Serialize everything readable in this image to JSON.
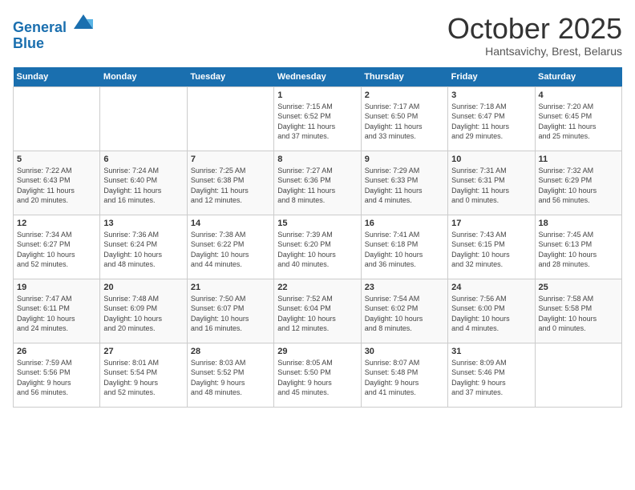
{
  "header": {
    "logo_line1": "General",
    "logo_line2": "Blue",
    "month": "October 2025",
    "location": "Hantsavichy, Brest, Belarus"
  },
  "weekdays": [
    "Sunday",
    "Monday",
    "Tuesday",
    "Wednesday",
    "Thursday",
    "Friday",
    "Saturday"
  ],
  "weeks": [
    [
      {
        "num": "",
        "detail": ""
      },
      {
        "num": "",
        "detail": ""
      },
      {
        "num": "",
        "detail": ""
      },
      {
        "num": "1",
        "detail": "Sunrise: 7:15 AM\nSunset: 6:52 PM\nDaylight: 11 hours\nand 37 minutes."
      },
      {
        "num": "2",
        "detail": "Sunrise: 7:17 AM\nSunset: 6:50 PM\nDaylight: 11 hours\nand 33 minutes."
      },
      {
        "num": "3",
        "detail": "Sunrise: 7:18 AM\nSunset: 6:47 PM\nDaylight: 11 hours\nand 29 minutes."
      },
      {
        "num": "4",
        "detail": "Sunrise: 7:20 AM\nSunset: 6:45 PM\nDaylight: 11 hours\nand 25 minutes."
      }
    ],
    [
      {
        "num": "5",
        "detail": "Sunrise: 7:22 AM\nSunset: 6:43 PM\nDaylight: 11 hours\nand 20 minutes."
      },
      {
        "num": "6",
        "detail": "Sunrise: 7:24 AM\nSunset: 6:40 PM\nDaylight: 11 hours\nand 16 minutes."
      },
      {
        "num": "7",
        "detail": "Sunrise: 7:25 AM\nSunset: 6:38 PM\nDaylight: 11 hours\nand 12 minutes."
      },
      {
        "num": "8",
        "detail": "Sunrise: 7:27 AM\nSunset: 6:36 PM\nDaylight: 11 hours\nand 8 minutes."
      },
      {
        "num": "9",
        "detail": "Sunrise: 7:29 AM\nSunset: 6:33 PM\nDaylight: 11 hours\nand 4 minutes."
      },
      {
        "num": "10",
        "detail": "Sunrise: 7:31 AM\nSunset: 6:31 PM\nDaylight: 11 hours\nand 0 minutes."
      },
      {
        "num": "11",
        "detail": "Sunrise: 7:32 AM\nSunset: 6:29 PM\nDaylight: 10 hours\nand 56 minutes."
      }
    ],
    [
      {
        "num": "12",
        "detail": "Sunrise: 7:34 AM\nSunset: 6:27 PM\nDaylight: 10 hours\nand 52 minutes."
      },
      {
        "num": "13",
        "detail": "Sunrise: 7:36 AM\nSunset: 6:24 PM\nDaylight: 10 hours\nand 48 minutes."
      },
      {
        "num": "14",
        "detail": "Sunrise: 7:38 AM\nSunset: 6:22 PM\nDaylight: 10 hours\nand 44 minutes."
      },
      {
        "num": "15",
        "detail": "Sunrise: 7:39 AM\nSunset: 6:20 PM\nDaylight: 10 hours\nand 40 minutes."
      },
      {
        "num": "16",
        "detail": "Sunrise: 7:41 AM\nSunset: 6:18 PM\nDaylight: 10 hours\nand 36 minutes."
      },
      {
        "num": "17",
        "detail": "Sunrise: 7:43 AM\nSunset: 6:15 PM\nDaylight: 10 hours\nand 32 minutes."
      },
      {
        "num": "18",
        "detail": "Sunrise: 7:45 AM\nSunset: 6:13 PM\nDaylight: 10 hours\nand 28 minutes."
      }
    ],
    [
      {
        "num": "19",
        "detail": "Sunrise: 7:47 AM\nSunset: 6:11 PM\nDaylight: 10 hours\nand 24 minutes."
      },
      {
        "num": "20",
        "detail": "Sunrise: 7:48 AM\nSunset: 6:09 PM\nDaylight: 10 hours\nand 20 minutes."
      },
      {
        "num": "21",
        "detail": "Sunrise: 7:50 AM\nSunset: 6:07 PM\nDaylight: 10 hours\nand 16 minutes."
      },
      {
        "num": "22",
        "detail": "Sunrise: 7:52 AM\nSunset: 6:04 PM\nDaylight: 10 hours\nand 12 minutes."
      },
      {
        "num": "23",
        "detail": "Sunrise: 7:54 AM\nSunset: 6:02 PM\nDaylight: 10 hours\nand 8 minutes."
      },
      {
        "num": "24",
        "detail": "Sunrise: 7:56 AM\nSunset: 6:00 PM\nDaylight: 10 hours\nand 4 minutes."
      },
      {
        "num": "25",
        "detail": "Sunrise: 7:58 AM\nSunset: 5:58 PM\nDaylight: 10 hours\nand 0 minutes."
      }
    ],
    [
      {
        "num": "26",
        "detail": "Sunrise: 7:59 AM\nSunset: 5:56 PM\nDaylight: 9 hours\nand 56 minutes."
      },
      {
        "num": "27",
        "detail": "Sunrise: 8:01 AM\nSunset: 5:54 PM\nDaylight: 9 hours\nand 52 minutes."
      },
      {
        "num": "28",
        "detail": "Sunrise: 8:03 AM\nSunset: 5:52 PM\nDaylight: 9 hours\nand 48 minutes."
      },
      {
        "num": "29",
        "detail": "Sunrise: 8:05 AM\nSunset: 5:50 PM\nDaylight: 9 hours\nand 45 minutes."
      },
      {
        "num": "30",
        "detail": "Sunrise: 8:07 AM\nSunset: 5:48 PM\nDaylight: 9 hours\nand 41 minutes."
      },
      {
        "num": "31",
        "detail": "Sunrise: 8:09 AM\nSunset: 5:46 PM\nDaylight: 9 hours\nand 37 minutes."
      },
      {
        "num": "",
        "detail": ""
      }
    ]
  ]
}
